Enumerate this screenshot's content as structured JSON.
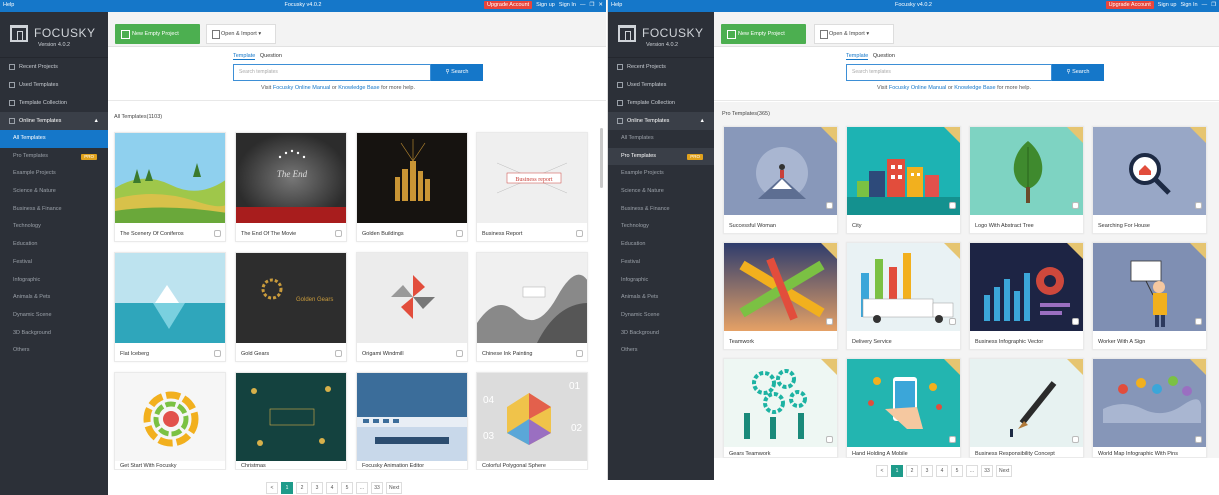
{
  "left": {
    "titlebar": {
      "help": "Help",
      "title": "Focusky v4.0.2",
      "upgrade": "Upgrade Account",
      "signup": "Sign up",
      "signin": "Sign In"
    },
    "logo": {
      "text": "FOCUSKY",
      "version": "Version 4.0.2"
    },
    "nav": [
      "Recent Projects",
      "Used Templates",
      "Template Collection"
    ],
    "online": "Online Templates",
    "sub": [
      {
        "label": "All Templates",
        "active": true
      },
      {
        "label": "Pro Templates",
        "badge": "PRO"
      },
      {
        "label": "Example Projects"
      },
      {
        "label": "Science & Nature"
      },
      {
        "label": "Business & Finance"
      },
      {
        "label": "Technology"
      },
      {
        "label": "Education"
      },
      {
        "label": "Festival"
      },
      {
        "label": "Infographic"
      },
      {
        "label": "Animals & Pets"
      },
      {
        "label": "Dynamic Scene"
      },
      {
        "label": "3D Background"
      },
      {
        "label": "Others"
      }
    ],
    "toolbar": {
      "new": "New Empty Project",
      "open": "Open & Import"
    },
    "search": {
      "tab1": "Template",
      "tab2": "Question",
      "placeholder": "Search templates",
      "button": "Search",
      "help_pre": "Visit",
      "help_link1": "Focusky Online Manual",
      "help_mid": "or",
      "help_link2": "Knowledge Base",
      "help_post": "for more help."
    },
    "section": "All Templates(1103)",
    "cards": [
      {
        "title": "The Scenery Of Coniferos"
      },
      {
        "title": "The End Of The Movie"
      },
      {
        "title": "Golden Buildings"
      },
      {
        "title": "Business Report"
      },
      {
        "title": "Flat Iceberg"
      },
      {
        "title": "Gold Gears"
      },
      {
        "title": "Origami Windmill"
      },
      {
        "title": "Chinese Ink Painting"
      },
      {
        "title": "Get Start With Focusky"
      },
      {
        "title": "Christmas"
      },
      {
        "title": "Focusky Animation Editor"
      },
      {
        "title": "Colorful Polygonal Sphere"
      }
    ],
    "thumb_text": {
      "end": "The End",
      "report": "Business report",
      "gears": "Golden Gears",
      "numbers": [
        "01",
        "02",
        "03",
        "04"
      ]
    },
    "pager": [
      "<",
      "1",
      "2",
      "3",
      "4",
      "5",
      "...",
      "33",
      "Next"
    ]
  },
  "right": {
    "titlebar": {
      "help": "Help",
      "title": "Focusky v4.0.2",
      "upgrade": "Upgrade Account",
      "signup": "Sign up",
      "signin": "Sign In"
    },
    "logo": {
      "text": "FOCUSKY",
      "version": "Version 4.0.2"
    },
    "nav": [
      "Recent Projects",
      "Used Templates",
      "Template Collection"
    ],
    "online": "Online Templates",
    "sub": [
      {
        "label": "All Templates"
      },
      {
        "label": "Pro Templates",
        "badge": "PRO",
        "active": true
      },
      {
        "label": "Example Projects"
      },
      {
        "label": "Science & Nature"
      },
      {
        "label": "Business & Finance"
      },
      {
        "label": "Technology"
      },
      {
        "label": "Education"
      },
      {
        "label": "Festival"
      },
      {
        "label": "Infographic"
      },
      {
        "label": "Animals & Pets"
      },
      {
        "label": "Dynamic Scene"
      },
      {
        "label": "3D Background"
      },
      {
        "label": "Others"
      }
    ],
    "toolbar": {
      "new": "New Empty Project",
      "open": "Open & Import"
    },
    "search": {
      "tab1": "Template",
      "tab2": "Question",
      "placeholder": "Search templates",
      "button": "Search",
      "help_pre": "Visit",
      "help_link1": "Focusky Online Manual",
      "help_mid": "or",
      "help_link2": "Knowledge Base",
      "help_post": "for more help."
    },
    "section": "Pro Templates(365)",
    "cards": [
      {
        "title": "Successful Woman"
      },
      {
        "title": "City"
      },
      {
        "title": "Logo With Abstract Tree"
      },
      {
        "title": "Searching For House"
      },
      {
        "title": "Teamwork"
      },
      {
        "title": "Delivery Service"
      },
      {
        "title": "Business Infographic Vector"
      },
      {
        "title": "Worker With A Sign"
      },
      {
        "title": "Gears Teamwork"
      },
      {
        "title": "Hand Holding A Mobile"
      },
      {
        "title": "Business Responsibility Concept"
      },
      {
        "title": "World Map Infographic With Pins"
      }
    ],
    "pager": [
      "<",
      "1",
      "2",
      "3",
      "4",
      "5",
      "...",
      "33",
      "Next"
    ]
  }
}
